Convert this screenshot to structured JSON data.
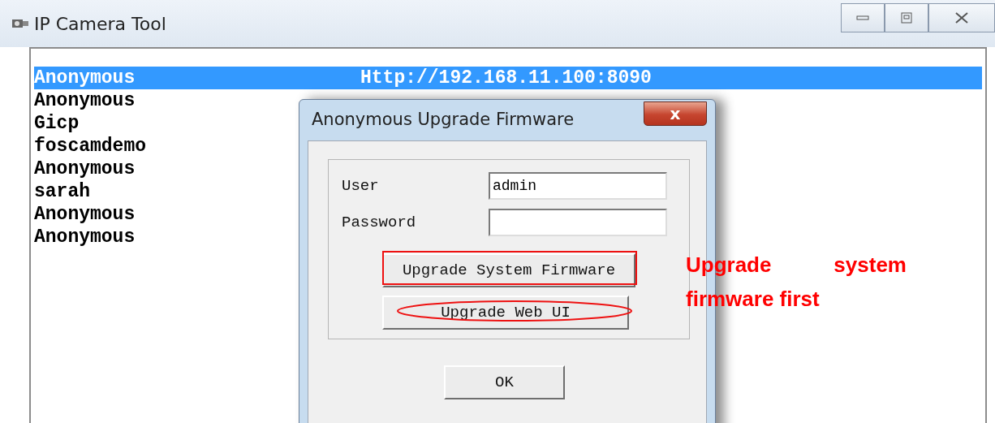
{
  "window": {
    "title": "IP Camera Tool"
  },
  "rows": [
    {
      "name": "Anonymous",
      "url": "Http://192.168.11.100:8090",
      "selected": true
    },
    {
      "name": "Anonymous",
      "selected": false
    },
    {
      "name": "Gicp",
      "selected": false
    },
    {
      "name": "foscamdemo",
      "selected": false
    },
    {
      "name": "Anonymous",
      "selected": false
    },
    {
      "name": "sarah",
      "selected": false
    },
    {
      "name": "Anonymous",
      "selected": false
    },
    {
      "name": "Anonymous",
      "selected": false
    }
  ],
  "dialog": {
    "title": "Anonymous Upgrade Firmware",
    "close": "x",
    "fields": [
      {
        "label": "User",
        "value": "admin"
      },
      {
        "label": "Password"
      }
    ],
    "buttons": [
      "Upgrade System Firmware",
      "Upgrade Web UI"
    ],
    "ok": "OK"
  },
  "annotation": "Upgrade system firmware first"
}
